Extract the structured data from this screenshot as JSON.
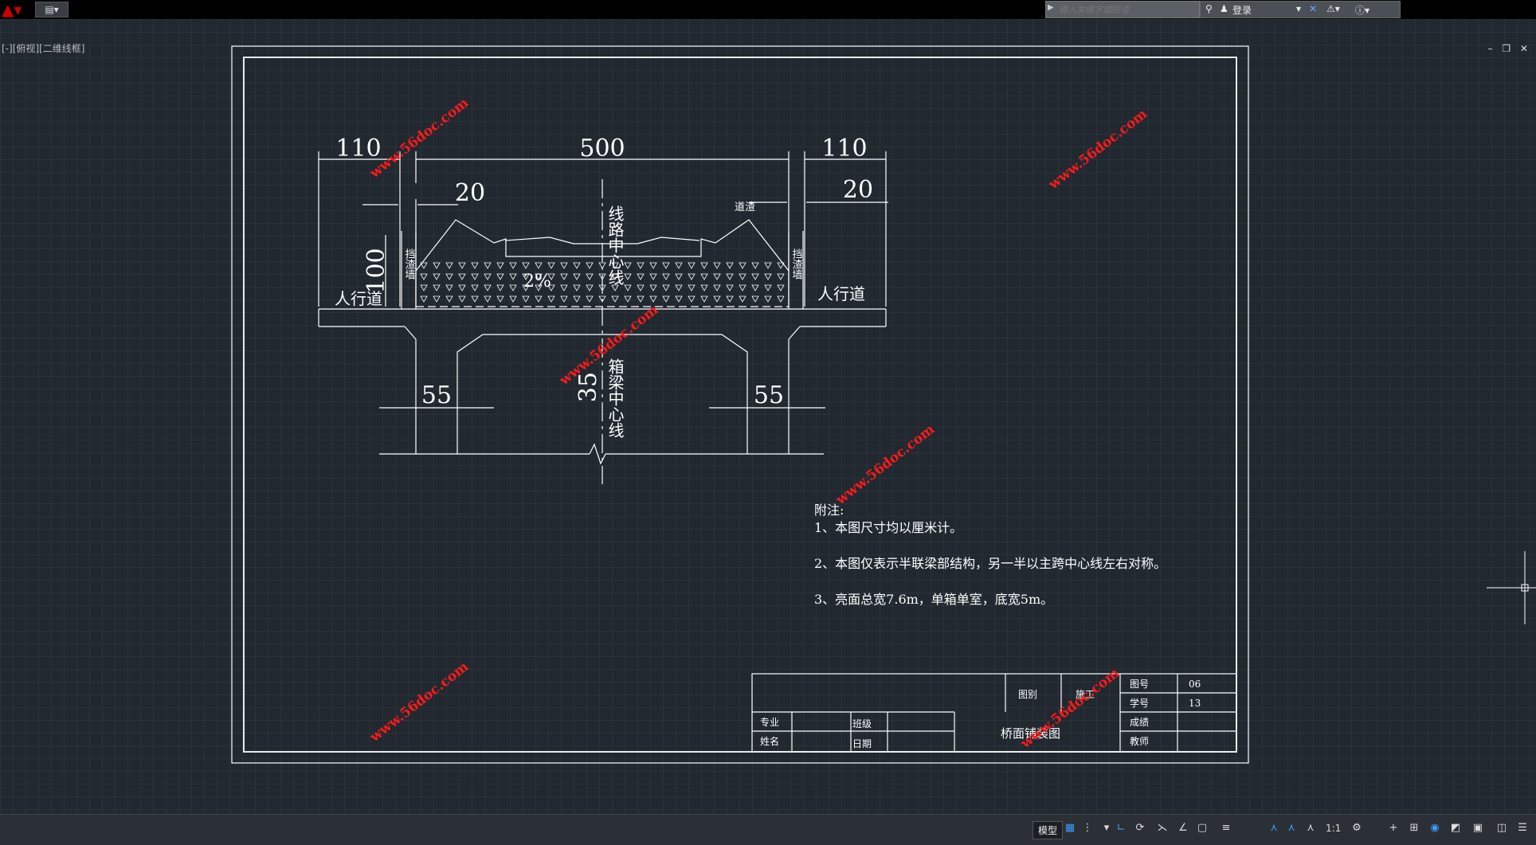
{
  "search": {
    "placeholder": "键入关键字或短语"
  },
  "login_label": "登录",
  "view_label": "[-][俯视][二维线框]",
  "drawing": {
    "dimensions": [
      "110",
      "500",
      "110",
      "20",
      "20",
      "100",
      "55",
      "55",
      "35"
    ],
    "labels": {
      "track_center": "线路中心线",
      "box_center": "箱梁中心线",
      "wall_left": "挡渣墙",
      "wall_right": "挡渣墙",
      "walkway_left": "人行道",
      "walkway_right": "人行道",
      "ballast": "道渣",
      "slope": "2%"
    },
    "notes": {
      "title": "附注:",
      "items": [
        "1、本图尺寸均以厘米计。",
        "2、本图仅表示半联梁部结构，另一半以主跨中心线左右对称。",
        "3、亮面总宽7.6m，单箱单室，底宽5m。"
      ]
    },
    "titleblock": {
      "drawing_type_label": "图别",
      "drawing_type_value": "施工",
      "drawing_no_label": "图号",
      "drawing_no_value": "06",
      "student_no_label": "学号",
      "student_no_value": "13",
      "major_label": "专业",
      "class_label": "班级",
      "name_label": "姓名",
      "date_label": "日期",
      "score_label": "成绩",
      "teacher_label": "教师",
      "drawing_title": "桥面铺装图"
    },
    "watermark": "www.56doc.com"
  },
  "status": {
    "model_label": "模型",
    "scale": "1:1"
  }
}
